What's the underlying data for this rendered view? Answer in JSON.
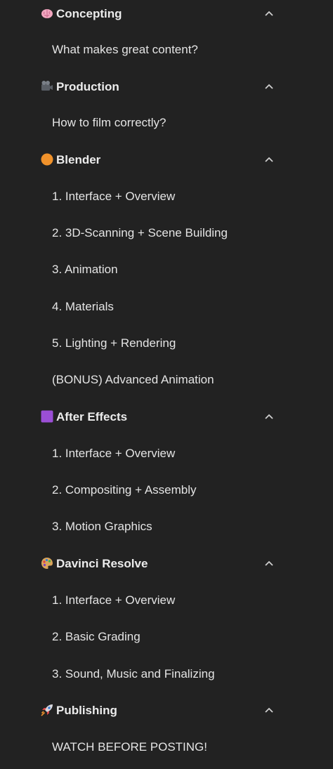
{
  "sections": [
    {
      "title": "Concepting",
      "icon": "brain-icon",
      "lessons": [
        "What makes great content?"
      ]
    },
    {
      "title": "Production",
      "icon": "film-camera-icon",
      "lessons": [
        "How to film correctly?"
      ]
    },
    {
      "title": "Blender",
      "icon": "orange-circle-icon",
      "lessons": [
        "1. Interface + Overview",
        "2. 3D-Scanning + Scene Building",
        "3. Animation",
        "4. Materials",
        "5. Lighting + Rendering",
        "(BONUS) Advanced Animation"
      ]
    },
    {
      "title": "After Effects",
      "icon": "purple-square-icon",
      "lessons": [
        "1. Interface + Overview",
        "2. Compositing + Assembly",
        "3. Motion Graphics"
      ]
    },
    {
      "title": "Davinci Resolve",
      "icon": "palette-icon",
      "lessons": [
        "1. Interface + Overview",
        "2. Basic Grading",
        "3. Sound, Music and Finalizing"
      ]
    },
    {
      "title": "Publishing",
      "icon": "rocket-icon",
      "lessons": [
        "WATCH BEFORE POSTING!"
      ]
    }
  ],
  "colors": {
    "background": "#222222",
    "text": "#ececec",
    "chevron": "#cfcfcf"
  }
}
